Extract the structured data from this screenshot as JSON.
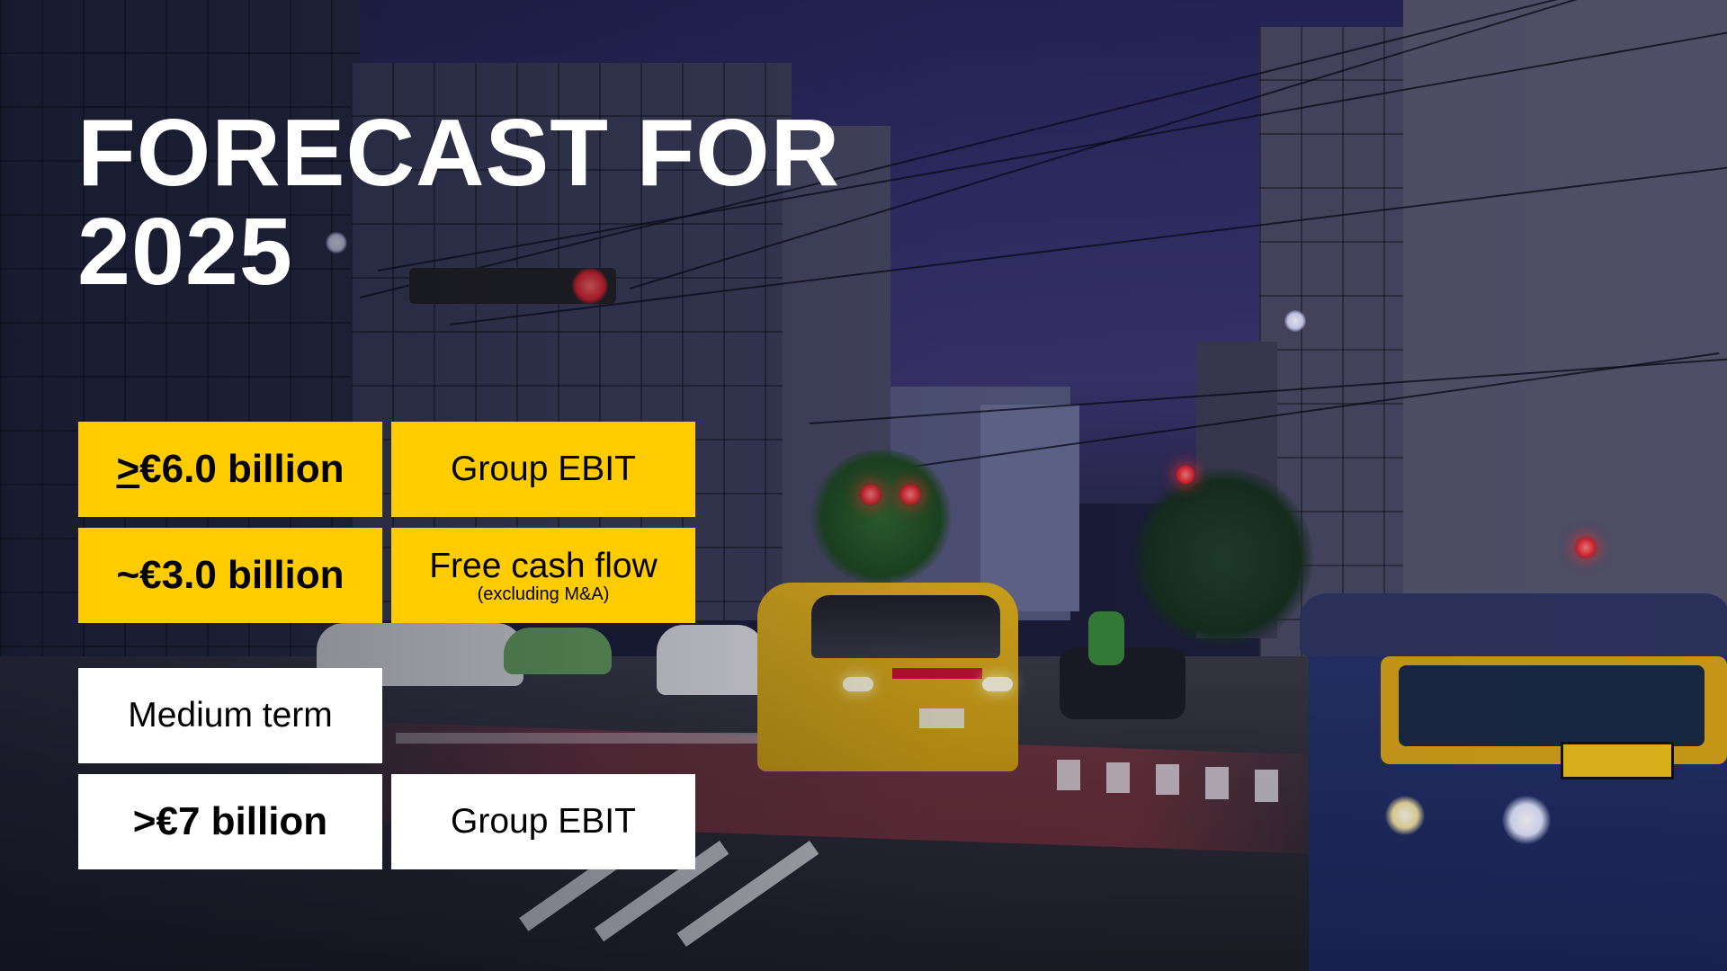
{
  "title": {
    "line1": "FORECAST FOR",
    "line2": "2025"
  },
  "forecast_2025": [
    {
      "value_prefix": ">",
      "value": "€6.0 billion",
      "label": "Group EBIT",
      "note": ""
    },
    {
      "value_prefix": "",
      "value": "~€3.0 billion",
      "label": "Free cash flow",
      "note": "(excluding M&A)"
    }
  ],
  "medium_term": {
    "heading": "Medium term",
    "value": ">€7 billion",
    "label": "Group EBIT"
  },
  "colors": {
    "accent_yellow": "#ffcc00",
    "text_white": "#ffffff",
    "box_white": "#ffffff"
  },
  "background": {
    "scene": "night-street-photo"
  }
}
